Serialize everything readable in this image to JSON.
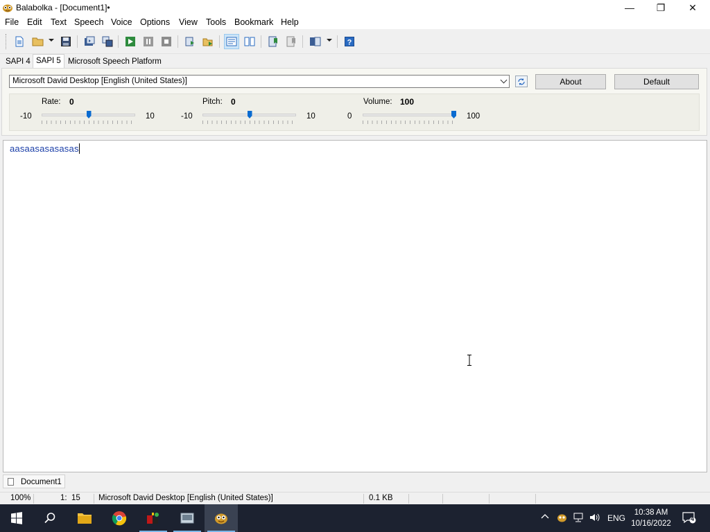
{
  "window": {
    "title": "Balabolka - [Document1]•",
    "minimize_glyph": "—",
    "maximize_glyph": "❐",
    "close_glyph": "✕"
  },
  "menu": [
    "File",
    "Edit",
    "Text",
    "Speech",
    "Voice",
    "Options",
    "View",
    "Tools",
    "Bookmark",
    "Help"
  ],
  "toolbar": {
    "icons": [
      "new-document-icon",
      "open-file-icon",
      "save-icon",
      "save-audio-icon",
      "batch-convert-icon",
      "play-icon",
      "pause-icon",
      "stop-icon",
      "read-clipboard-icon",
      "read-clipboard-files-icon",
      "active-view-icon",
      "split-view-icon",
      "previous-bookmark-icon",
      "next-bookmark-icon",
      "dictionary-icon",
      "help-icon"
    ]
  },
  "engine_tabs": [
    {
      "label": "SAPI 4",
      "active": false
    },
    {
      "label": "SAPI 5",
      "active": true
    },
    {
      "label": "Microsoft Speech Platform",
      "active": false
    }
  ],
  "voice": {
    "selected": "Microsoft David Desktop [English (United States)]",
    "about_label": "About",
    "default_label": "Default"
  },
  "sliders": {
    "rate": {
      "label": "Rate:",
      "value": "0",
      "min": "-10",
      "max": "10",
      "fraction": 0.5
    },
    "pitch": {
      "label": "Pitch:",
      "value": "0",
      "min": "-10",
      "max": "10",
      "fraction": 0.5
    },
    "volume": {
      "label": "Volume:",
      "value": "100",
      "min": "0",
      "max": "100",
      "fraction": 1.0
    }
  },
  "editor": {
    "text": "aasaasasasasas"
  },
  "document_tab": "Document1",
  "status": {
    "zoom": "100%",
    "position": "1:  15",
    "voice": "Microsoft David Desktop [English (United States)]",
    "size": "0.1 KB"
  },
  "taskbar": {
    "items": [
      "start-icon",
      "search-icon",
      "file-explorer-icon",
      "chrome-icon",
      "app-icon",
      "app-icon-2",
      "balabolka-icon"
    ],
    "language": "ENG",
    "time": "10:38 AM",
    "date": "10/16/2022",
    "notification_count": "4"
  }
}
